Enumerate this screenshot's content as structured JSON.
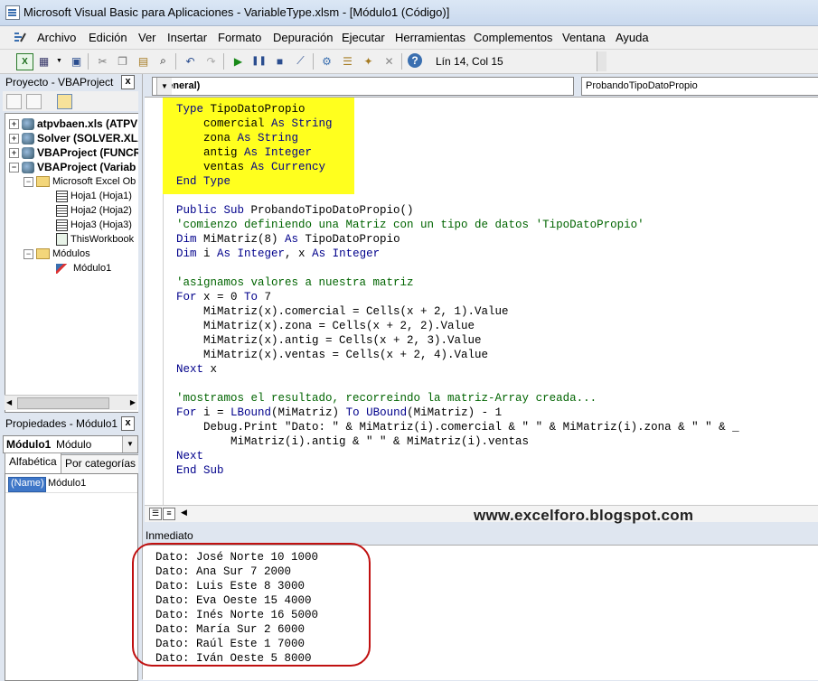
{
  "window": {
    "title": "Microsoft Visual Basic para Aplicaciones - VariableType.xlsm - [Módulo1 (Código)]"
  },
  "menu": [
    "Archivo",
    "Edición",
    "Ver",
    "Insertar",
    "Formato",
    "Depuración",
    "Ejecutar",
    "Herramientas",
    "Complementos",
    "Ventana",
    "Ayuda"
  ],
  "toolbar": {
    "position": "Lín 14, Col 15"
  },
  "project": {
    "title": "Proyecto - VBAProject",
    "close": "x",
    "items": [
      "atpvbaen.xls (ATPV",
      "Solver (SOLVER.XLA",
      "VBAProject (FUNCR",
      "VBAProject (Variab",
      "Microsoft Excel Ob",
      "Hoja1 (Hoja1)",
      "Hoja2 (Hoja2)",
      "Hoja3 (Hoja3)",
      "ThisWorkbook",
      "Módulos",
      "Módulo1"
    ]
  },
  "properties": {
    "title": "Propiedades - Módulo1",
    "close": "x",
    "object_name": "Módulo1",
    "object_type": "Módulo",
    "tab_alpha": "Alfabética",
    "tab_cat": "Por categorías",
    "prop_name": "(Name)",
    "prop_value": "Módulo1"
  },
  "editor": {
    "object_combo": "(General)",
    "proc_combo": "ProbandoTipoDatoPropio",
    "code_lines": [
      [
        [
          "kw",
          "Type "
        ],
        [
          "t",
          "TipoDatoPropio"
        ]
      ],
      [
        [
          "t",
          "    comercial "
        ],
        [
          "kw",
          "As String"
        ]
      ],
      [
        [
          "t",
          "    zona "
        ],
        [
          "kw",
          "As String"
        ]
      ],
      [
        [
          "t",
          "    antig "
        ],
        [
          "kw",
          "As Integer"
        ]
      ],
      [
        [
          "t",
          "    ventas "
        ],
        [
          "kw",
          "As Currency"
        ]
      ],
      [
        [
          "kw",
          "End Type"
        ]
      ],
      [
        [
          "t",
          ""
        ]
      ],
      [
        [
          "kw",
          "Public Sub "
        ],
        [
          "t",
          "ProbandoTipoDatoPropio()"
        ]
      ],
      [
        [
          "cm",
          "'comienzo definiendo una Matriz con un tipo de datos 'TipoDatoPropio'"
        ]
      ],
      [
        [
          "kw",
          "Dim "
        ],
        [
          "t",
          "MiMatriz(8) "
        ],
        [
          "kw",
          "As "
        ],
        [
          "t",
          "TipoDatoPropio"
        ]
      ],
      [
        [
          "kw",
          "Dim "
        ],
        [
          "t",
          "i "
        ],
        [
          "kw",
          "As Integer"
        ],
        [
          "t",
          ", x "
        ],
        [
          "kw",
          "As Integer"
        ]
      ],
      [
        [
          "t",
          ""
        ]
      ],
      [
        [
          "cm",
          "'asignamos valores a nuestra matriz"
        ]
      ],
      [
        [
          "kw",
          "For "
        ],
        [
          "t",
          "x = 0 "
        ],
        [
          "kw",
          "To "
        ],
        [
          "t",
          "7"
        ]
      ],
      [
        [
          "t",
          "    MiMatriz(x).comercial = Cells(x + 2, 1).Value"
        ]
      ],
      [
        [
          "t",
          "    MiMatriz(x).zona = Cells(x + 2, 2).Value"
        ]
      ],
      [
        [
          "t",
          "    MiMatriz(x).antig = Cells(x + 2, 3).Value"
        ]
      ],
      [
        [
          "t",
          "    MiMatriz(x).ventas = Cells(x + 2, 4).Value"
        ]
      ],
      [
        [
          "kw",
          "Next "
        ],
        [
          "t",
          "x"
        ]
      ],
      [
        [
          "t",
          ""
        ]
      ],
      [
        [
          "cm",
          "'mostramos el resultado, recorreindo la matriz-Array creada..."
        ]
      ],
      [
        [
          "kw",
          "For "
        ],
        [
          "t",
          "i = "
        ],
        [
          "kw",
          "LBound"
        ],
        [
          "t",
          "(MiMatriz) "
        ],
        [
          "kw",
          "To UBound"
        ],
        [
          "t",
          "(MiMatriz) - 1"
        ]
      ],
      [
        [
          "t",
          "    Debug.Print \"Dato: \" & MiMatriz(i).comercial & \" \" & MiMatriz(i).zona & \" \" & _"
        ]
      ],
      [
        [
          "t",
          "        MiMatriz(i).antig & \" \" & MiMatriz(i).ventas"
        ]
      ],
      [
        [
          "kw",
          "Next"
        ]
      ],
      [
        [
          "kw",
          "End Sub"
        ]
      ]
    ]
  },
  "watermark": "www.excelforo.blogspot.com",
  "immediate": {
    "title": "Inmediato",
    "lines": [
      "Dato: José Norte 10 1000",
      "Dato: Ana Sur 7 2000",
      "Dato: Luis Este 8 3000",
      "Dato: Eva Oeste 15 4000",
      "Dato: Inés Norte 16 5000",
      "Dato: María Sur 2 6000",
      "Dato: Raúl Este 1 7000",
      "Dato: Iván Oeste 5 8000"
    ]
  }
}
